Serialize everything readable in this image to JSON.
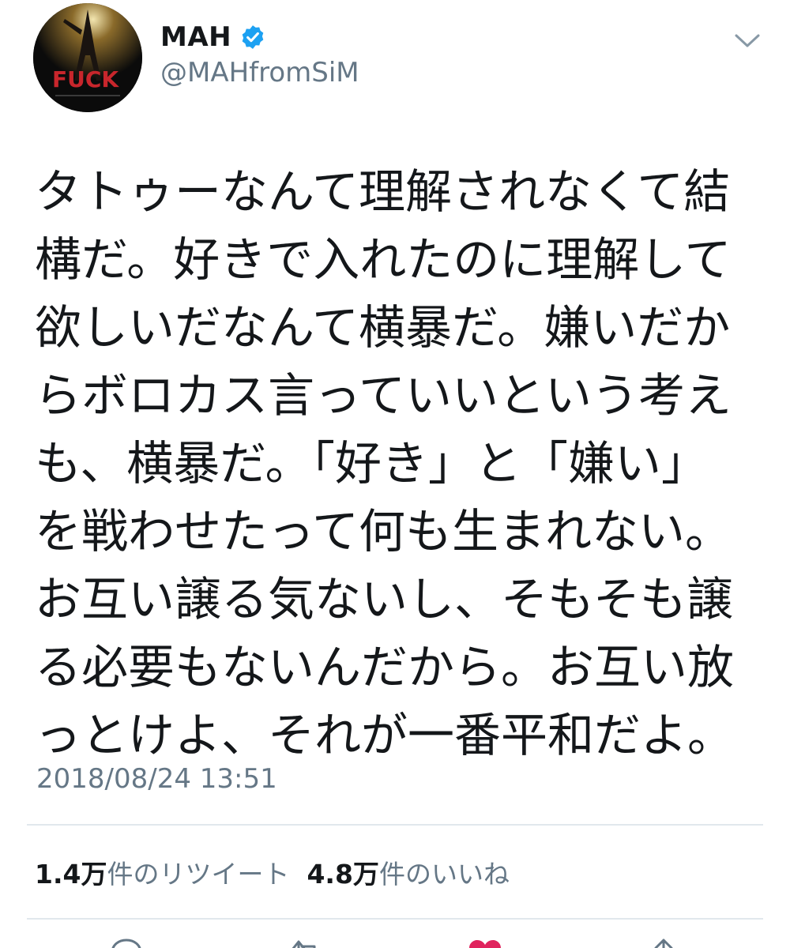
{
  "user": {
    "display_name": "MAH",
    "handle": "@MAHfromSiM",
    "verified": true,
    "avatar_text": "FUCK"
  },
  "tweet": {
    "lines": [
      "タトゥーなんて理解されなくて結",
      "構だ。好きで入れたのに理解して",
      "欲しいだなんて横暴だ。嫌いだか",
      "らボロカス言っていいという考え",
      "も、横暴だ。「好き」と「嫌い」",
      "を戦わせたって何も生まれない。",
      "お互い譲る気ないし、そもそも譲",
      "る必要もないんだから。お互い放",
      "っとけよ、それが一番平和だよ。"
    ],
    "timestamp": "2018/08/24 13:51"
  },
  "stats": {
    "retweets_count": "1.4万",
    "retweets_label": "件のリツイート",
    "likes_count": "4.8万",
    "likes_label": "件のいいね"
  },
  "icons": {
    "verified": "verified-badge-icon",
    "caret": "chevron-down-icon",
    "reply": "reply-icon",
    "retweet": "retweet-icon",
    "like": "heart-icon",
    "share": "share-icon"
  },
  "colors": {
    "text": "#14171a",
    "secondary": "#657786",
    "verified": "#1da1f2",
    "like": "#e0245e",
    "divider": "#e1e8ed"
  }
}
